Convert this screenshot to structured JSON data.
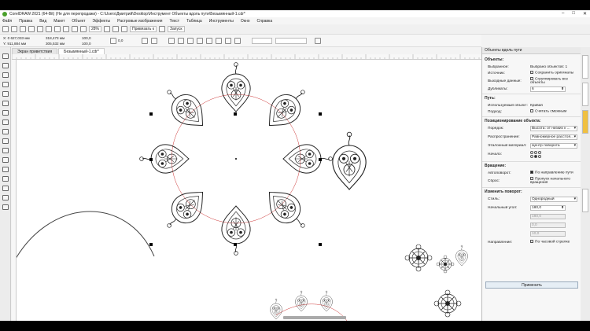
{
  "window": {
    "title": "CorelDRAW 2021 (64-Bit) (Не для перепродажи) - C:\\Users\\Дмитрий\\Desktop\\Инструмент Объекты вдоль пути\\Безымянный-1.cdr*"
  },
  "menu": [
    "Файл",
    "Правка",
    "Вид",
    "Макет",
    "Объект",
    "Эффекты",
    "Растровые изображения",
    "Текст",
    "Таблица",
    "Инструменты",
    "Окно",
    "Справка"
  ],
  "toolbar": {
    "zoom": "28%",
    "snap": "Привязать к",
    "launch": "Запуск"
  },
  "propbar": {
    "x": "X: 0 627,033 мм",
    "y": "Y: 911,884 мм",
    "w": "318,473 мм",
    "h": "305,532 мм",
    "sx": "100,0",
    "sy": "100,0",
    "angle": "0,0"
  },
  "tabs": [
    "Экран приветствия",
    "Безымянный-1.cdr*"
  ],
  "docker": {
    "title": "Объекты вдоль пути",
    "sec_objects": "Объекты:",
    "selected_label": "Выбранное:",
    "selected_value": "Выбрано объектов: 1",
    "source_label": "Источник:",
    "source_value": "Сохранить оригиналы",
    "output_label": "Выходные данные:",
    "output_value": "Сгруппировать все объекты",
    "dups_label": "Дубликаты:",
    "dups_value": "6",
    "sec_path": "Путь:",
    "path_obj_label": "Используемый объект:",
    "path_obj_value": "Кривая",
    "approach_label": "Подход:",
    "approach_value": "Считать смежным",
    "sec_pos": "Позиционирование объекта:",
    "order_label": "Порядок:",
    "order_value": "Высота: от низких к ...",
    "dist_label": "Распространение:",
    "dist_value": "Равномерное расстоя...",
    "ref_label": "Эталонный материал:",
    "ref_value": "Центр поворота",
    "start_label": "Начало:",
    "sec_rot": "Вращение:",
    "autorot_label": "Автоповорот:",
    "autorot_value": "По направлению пути",
    "reset_label": "Сброс:",
    "reset_value": "Пропуск начального вращения",
    "sec_change": "Изменить поворот:",
    "style_label": "Стиль:",
    "style_value": "Однородный",
    "start_angle_label": "Начальный угол:",
    "start_angle_value": "180,0",
    "f1": "180,0",
    "f2": "0,0",
    "f3": "10,0",
    "direction_label": "Направление:",
    "direction_value": "По часовой стрелке",
    "apply": "Применить"
  }
}
